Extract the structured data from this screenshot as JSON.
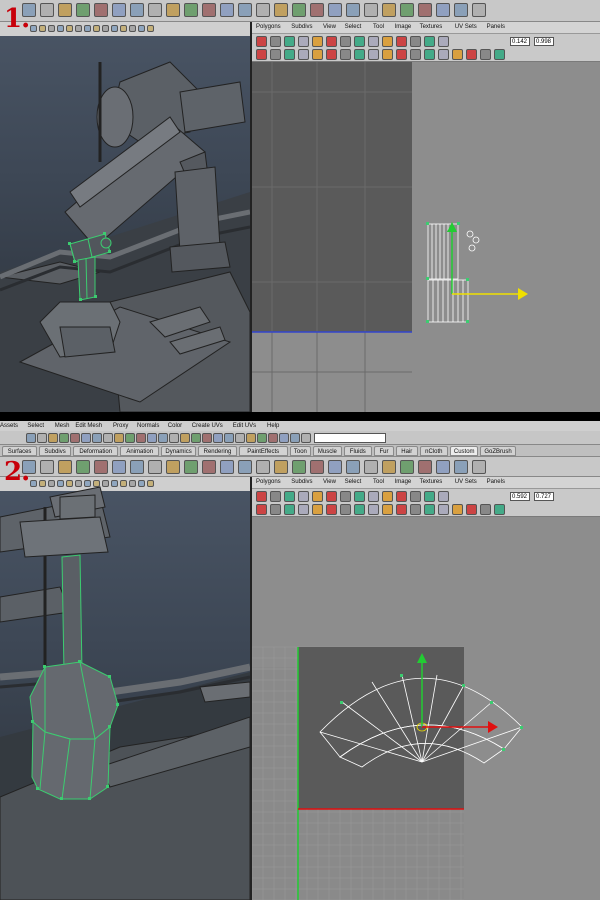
{
  "panel_1": {
    "step_label": "1.",
    "uv_editor": {
      "menu": [
        "Polygons",
        "Subdivs",
        "View",
        "Select",
        "Tool",
        "Image",
        "Textures",
        "UV Sets",
        "Panels"
      ],
      "u_value": "0.142",
      "v_value": "0.998"
    }
  },
  "panel_2": {
    "step_label": "2.",
    "main_menu": [
      "Assets",
      "Select",
      "Mesh",
      "Edit Mesh",
      "Proxy",
      "Normals",
      "Color",
      "Create UVs",
      "Edit UVs",
      "Help"
    ],
    "shelf_tabs": [
      "Surfaces",
      "Subdivs",
      "Deformation",
      "Animation",
      "Dynamics",
      "Rendering",
      "PaintEffects",
      "Toon",
      "Muscle",
      "Fluids",
      "Fur",
      "Hair",
      "nCloth",
      "Custom",
      "GoZBrush"
    ],
    "active_tab": "Custom",
    "uv_editor": {
      "menu": [
        "Polygons",
        "Subdivs",
        "View",
        "Select",
        "Tool",
        "Image",
        "Textures",
        "UV Sets",
        "Panels"
      ],
      "u_value": "0.592",
      "v_value": "0.727"
    }
  },
  "colors": {
    "step_number": "#c8000a",
    "selection_green": "#3ccc70",
    "manip_y": "#22cc33",
    "manip_x_uv1": "#f0e000",
    "manip_x_uv2": "#e01010",
    "uv_shell": "#ffffff"
  }
}
